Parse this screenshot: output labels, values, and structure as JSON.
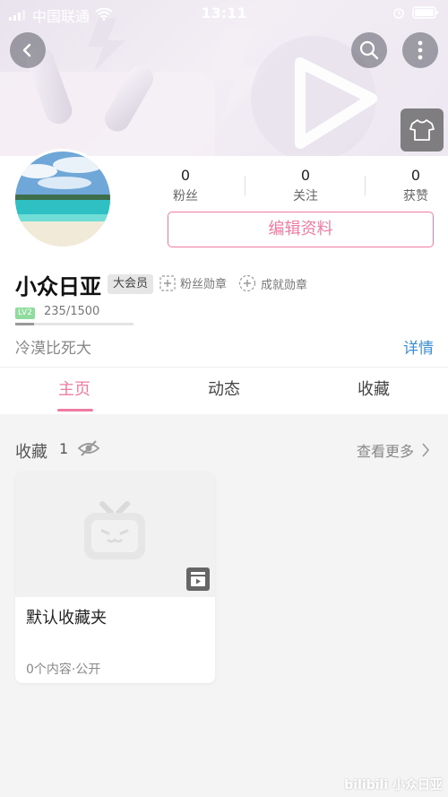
{
  "status_bar": {
    "carrier": "中国联通",
    "time": "13:11"
  },
  "profile": {
    "stats": [
      {
        "value": "0",
        "label": "粉丝"
      },
      {
        "value": "0",
        "label": "关注"
      },
      {
        "value": "0",
        "label": "获赞"
      }
    ],
    "edit_button": "编辑资料",
    "username": "小众日亚",
    "vip_badge": "大会员",
    "fan_medal": "粉丝勋章",
    "achievement_medal": "成就勋章",
    "level": "LV2",
    "exp": "235/1500",
    "exp_progress": 0.157,
    "signature": "冷漠比死大",
    "detail_link": "详情"
  },
  "tabs": [
    {
      "label": "主页",
      "active": true
    },
    {
      "label": "动态",
      "active": false
    },
    {
      "label": "收藏",
      "active": false
    }
  ],
  "favorites": {
    "title": "收藏",
    "count": "1",
    "more": "查看更多",
    "folders": [
      {
        "name": "默认收藏夹",
        "meta": "0个内容·公开"
      }
    ]
  },
  "watermark": "bilibili 小众日亚",
  "colors": {
    "accent_pink": "#f07ba1",
    "link_blue": "#3b8fd4",
    "level_green": "#8fdc9e"
  }
}
